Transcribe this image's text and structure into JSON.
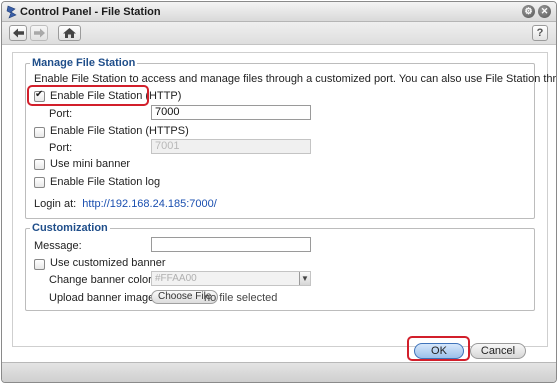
{
  "window": {
    "title": "Control Panel - File Station"
  },
  "toolbar": {
    "help_label": "?"
  },
  "manage": {
    "legend": "Manage File Station",
    "description": "Enable File Station to access and manage files through a customized port. You can also use File Station through mobile devices.",
    "http": {
      "label": "Enable File Station (HTTP)",
      "checked": true,
      "port_label": "Port:",
      "port_value": "7000"
    },
    "https": {
      "label": "Enable File Station (HTTPS)",
      "checked": false,
      "port_label": "Port:",
      "port_value": "7001"
    },
    "mini_banner": {
      "label": "Use mini banner",
      "checked": false
    },
    "log": {
      "label": "Enable File Station log",
      "checked": false
    },
    "login_label": "Login at:",
    "login_url": "http://192.168.24.185:7000/"
  },
  "customization": {
    "legend": "Customization",
    "message_label": "Message:",
    "message_value": "",
    "custom_banner": {
      "label": "Use customized banner",
      "checked": false
    },
    "banner_color_label": "Change banner color:",
    "banner_color_value": "#FFAA00",
    "upload_label": "Upload banner image:",
    "choose_file_label": "Choose File",
    "no_file_label": "no file selected"
  },
  "actions": {
    "ok_label": "OK",
    "cancel_label": "Cancel"
  },
  "colors": {
    "highlight": "#d21f2b",
    "accent": "#1f4e8a",
    "link": "#1a4fb0"
  },
  "icons": [
    "control-panel-icon",
    "back-arrow-icon",
    "forward-arrow-icon",
    "home-icon",
    "help-icon",
    "settings-icon",
    "close-icon"
  ]
}
